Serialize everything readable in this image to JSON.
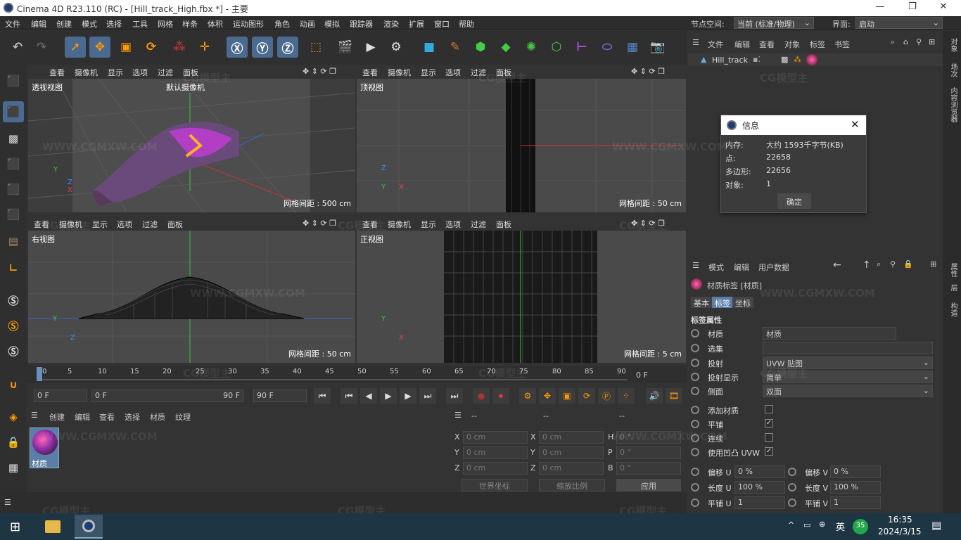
{
  "titlebar": {
    "title": "Cinema 4D R23.110 (RC) - [Hill_track_High.fbx *] - 主要"
  },
  "menu": {
    "items": [
      "文件",
      "编辑",
      "创建",
      "模式",
      "选择",
      "工具",
      "网格",
      "样条",
      "体积",
      "运动图形",
      "角色",
      "动画",
      "模拟",
      "跟踪器",
      "渲染",
      "扩展",
      "窗口",
      "帮助"
    ],
    "node_space_label": "节点空间:",
    "node_space_value": "当前 (标准/物理)",
    "interface_label": "界面:",
    "interface_value": "启动"
  },
  "viewports": {
    "header_items": [
      "查看",
      "摄像机",
      "显示",
      "选项",
      "过滤",
      "面板"
    ],
    "perspective": {
      "label": "透视视图",
      "camera": "默认摄像机",
      "grid": "网格间距 : 500 cm"
    },
    "top": {
      "label": "顶视图",
      "grid": "网格间距 : 50 cm"
    },
    "right": {
      "label": "右视图",
      "grid": "网格间距 : 50 cm"
    },
    "front": {
      "label": "正视图",
      "grid": "网格间距 : 5 cm"
    }
  },
  "timeline": {
    "ticks": [
      "0",
      "5",
      "10",
      "15",
      "20",
      "25",
      "30",
      "35",
      "40",
      "45",
      "50",
      "55",
      "60",
      "65",
      "70",
      "75",
      "80",
      "85",
      "90"
    ],
    "end_label": "0 F"
  },
  "playbar": {
    "current": "0 F",
    "range_start": "0 F",
    "range_end": "90 F",
    "max": "90 F"
  },
  "material_manager": {
    "menu": [
      "创建",
      "编辑",
      "查看",
      "选择",
      "材质",
      "纹理"
    ],
    "material_name": "材质"
  },
  "coords": {
    "headers": [
      "--",
      "--",
      "--"
    ],
    "rows": [
      {
        "a": "X",
        "av": "0 cm",
        "b": "X",
        "bv": "0 cm",
        "c": "H",
        "cv": "0 °"
      },
      {
        "a": "Y",
        "av": "0 cm",
        "b": "Y",
        "bv": "0 cm",
        "c": "P",
        "cv": "0 °"
      },
      {
        "a": "Z",
        "av": "0 cm",
        "b": "Z",
        "bv": "0 cm",
        "c": "B",
        "cv": "0 °"
      }
    ],
    "world": "世界坐标",
    "scale": "缩放比例",
    "apply": "应用"
  },
  "object_manager": {
    "menu": [
      "文件",
      "编辑",
      "查看",
      "对象",
      "标签",
      "书签"
    ],
    "object_name": "Hill_track"
  },
  "info_dialog": {
    "title": "信息",
    "rows": [
      {
        "label": "内存:",
        "value": "大约 1593千字节(KB)"
      },
      {
        "label": "点:",
        "value": "22658"
      },
      {
        "label": "多边形:",
        "value": "22656"
      },
      {
        "label": "对象:",
        "value": "1"
      }
    ],
    "ok": "确定"
  },
  "attributes": {
    "menu": [
      "模式",
      "编辑",
      "用户数据"
    ],
    "header": "材质标签 [材质]",
    "tabs": [
      "基本",
      "标签",
      "坐标"
    ],
    "section": "标签属性",
    "material_label": "材质",
    "material_value": "材质",
    "selection_label": "选集",
    "projection_label": "投射",
    "projection_value": "UVW 贴图",
    "proj_display_label": "投射显示",
    "proj_display_value": "简单",
    "side_label": "侧面",
    "side_value": "双面",
    "add_material_label": "添加材质",
    "tile_label": "平铺",
    "seamless_label": "连续",
    "bump_uvw_label": "使用凹凸 UVW",
    "offset_u_label": "偏移 U",
    "offset_u_value": "0 %",
    "offset_v_label": "偏移 V",
    "offset_v_value": "0 %",
    "length_u_label": "长度 U",
    "length_u_value": "100 %",
    "length_v_label": "长度 V",
    "length_v_value": "100 %",
    "tiles_u_label": "平铺 U",
    "tiles_u_value": "1",
    "tiles_v_label": "平铺 V",
    "tiles_v_value": "1"
  },
  "right_strip": [
    "对象",
    "场次",
    "内容浏览器",
    "属性",
    "层",
    "构造"
  ],
  "taskbar": {
    "time": "16:35",
    "date": "2024/3/15",
    "ime": "英",
    "badge": "35"
  },
  "watermarks": [
    "CG模型主",
    "WWW.CGMXW.COM"
  ]
}
